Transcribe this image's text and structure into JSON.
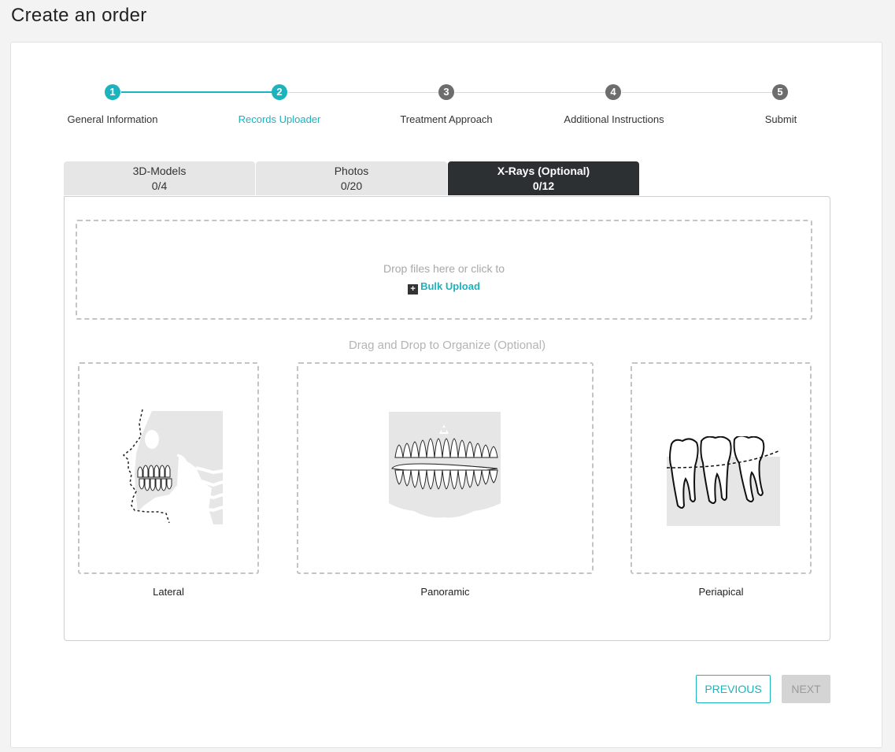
{
  "page": {
    "title": "Create an order"
  },
  "stepper": {
    "steps": [
      {
        "number": "1",
        "label": "General Information",
        "state": "completed"
      },
      {
        "number": "2",
        "label": "Records Uploader",
        "state": "active"
      },
      {
        "number": "3",
        "label": "Treatment Approach",
        "state": "pending"
      },
      {
        "number": "4",
        "label": "Additional Instructions",
        "state": "pending"
      },
      {
        "number": "5",
        "label": "Submit",
        "state": "pending"
      }
    ]
  },
  "tabs": [
    {
      "name": "3D-Models",
      "count": "0/4"
    },
    {
      "name": "Photos",
      "count": "0/20"
    },
    {
      "name": "X-Rays (Optional)",
      "count": "0/12",
      "active": true
    }
  ],
  "dropzone": {
    "text": "Drop files here or click to",
    "bulk_upload": "Bulk Upload",
    "bulk_icon": "+"
  },
  "organize": {
    "title": "Drag and Drop to Organize (Optional)",
    "slots": [
      {
        "label": "Lateral",
        "icon": "lateral-xray-icon"
      },
      {
        "label": "Panoramic",
        "icon": "panoramic-xray-icon"
      },
      {
        "label": "Periapical",
        "icon": "periapical-xray-icon"
      }
    ]
  },
  "buttons": {
    "previous": "PREVIOUS",
    "next": "NEXT"
  },
  "colors": {
    "accent": "#1ab3be",
    "active_tab": "#2d3033",
    "disabled": "#d4d4d4"
  }
}
